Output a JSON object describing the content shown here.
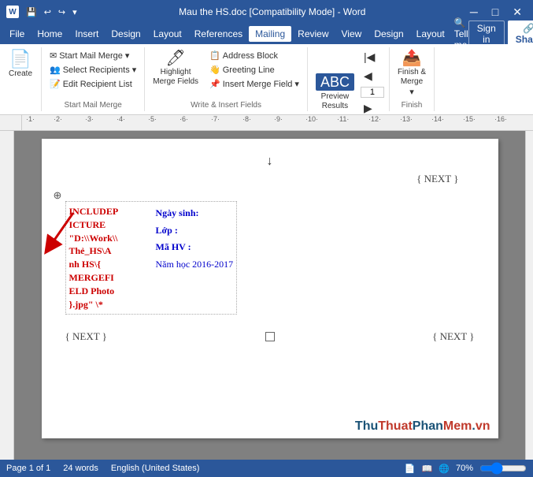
{
  "titleBar": {
    "title": "Mau the HS.doc [Compatibility Mode] - Word",
    "controls": [
      "minimize",
      "maximize",
      "close"
    ],
    "quickAccess": [
      "save",
      "undo",
      "redo",
      "customize"
    ]
  },
  "menuBar": {
    "items": [
      "File",
      "Home",
      "Insert",
      "Design",
      "Layout",
      "References",
      "Mailing",
      "Review",
      "View",
      "Design",
      "Layout"
    ],
    "activeItem": "Mailing",
    "tellMe": "Tell me",
    "signIn": "Sign in",
    "share": "Share"
  },
  "ribbon": {
    "groups": [
      {
        "label": "Start Mail Merge",
        "buttons": [
          {
            "id": "start-mail-merge",
            "label": "Start Mail Merge",
            "icon": "✉"
          },
          {
            "id": "select-recipients",
            "label": "Select Recipients",
            "icon": "👥"
          },
          {
            "id": "edit-recipient-list",
            "label": "Edit Recipient List",
            "icon": "📝"
          }
        ]
      },
      {
        "label": "Write & Insert Fields",
        "buttons": [
          {
            "id": "highlight-merge-fields",
            "label": "Highlight\nMerge Fields",
            "icon": "🖊"
          },
          {
            "id": "address-block",
            "label": "Address Block",
            "icon": "📋"
          },
          {
            "id": "greeting-line",
            "label": "Greeting Line",
            "icon": "👋"
          },
          {
            "id": "insert-merge-field",
            "label": "Insert Merge Field",
            "icon": "📌"
          }
        ]
      },
      {
        "label": "",
        "buttons": [
          {
            "id": "preview-results",
            "label": "Preview\nResults",
            "icon": "ABC"
          },
          {
            "id": "find-recipient",
            "label": "",
            "icon": "🔍"
          },
          {
            "id": "check-errors",
            "label": "",
            "icon": "⚠"
          }
        ]
      },
      {
        "label": "Finish",
        "buttons": [
          {
            "id": "finish-merge",
            "label": "Finish &\nMerge",
            "icon": "✓"
          }
        ]
      }
    ]
  },
  "document": {
    "nextField1": "{ NEXT }",
    "nextField2": "{ NEXT }",
    "nextField3": "{ NEXT }",
    "includeField": "INCLUDEP\nICTURE\n\"D:\\\\Work\\\\\nThẻ_HS\\A\nnh HS\\{\nMERGEFI\nELD Photo\n}.jpg\" \\*",
    "studentInfo": {
      "ngaySinh": "Ngày sinh:",
      "lop": "Lớp        :",
      "maHV": "Mã HV    :",
      "namHoc": "Năm học 2016-2017"
    },
    "downArrow": "↓",
    "anchorSymbol": "⊕"
  },
  "statusBar": {
    "page": "Page 1 of 1",
    "words": "24 words",
    "language": "English (United States)",
    "zoom": "70%"
  },
  "watermark": {
    "text": "ThuThuatPhanMem.vn"
  }
}
